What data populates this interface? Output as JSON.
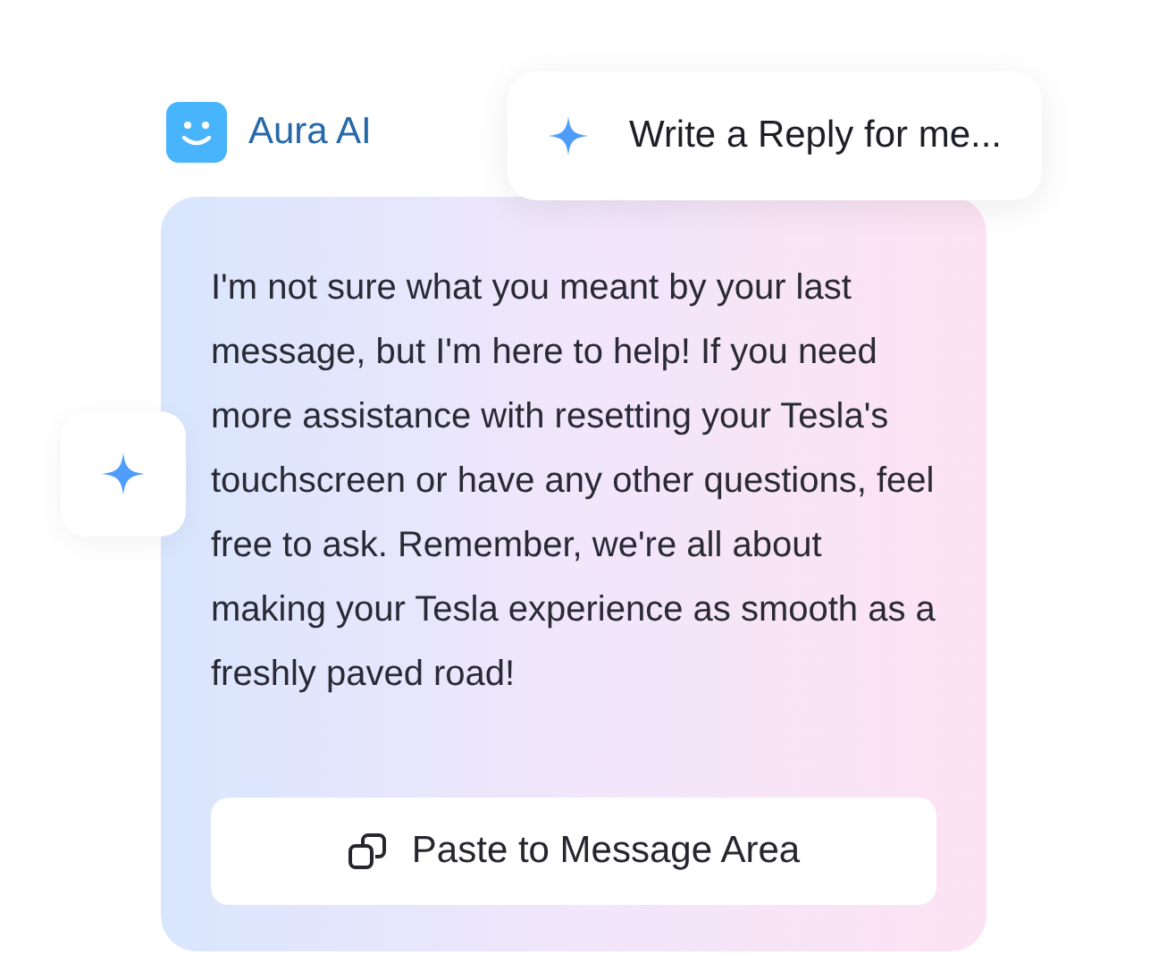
{
  "assistant": {
    "name": "Aura AI"
  },
  "suggestion": {
    "label": "Write a Reply for me..."
  },
  "message": {
    "text": "I'm not sure what you meant by your last message, but I'm here to help! If you need more assistance with resetting your Tesla's touchscreen or have any other questions, feel free to ask. Remember, we're all about making your Tesla experience as smooth as a freshly paved road!"
  },
  "action": {
    "label": "Paste to Message Area"
  }
}
